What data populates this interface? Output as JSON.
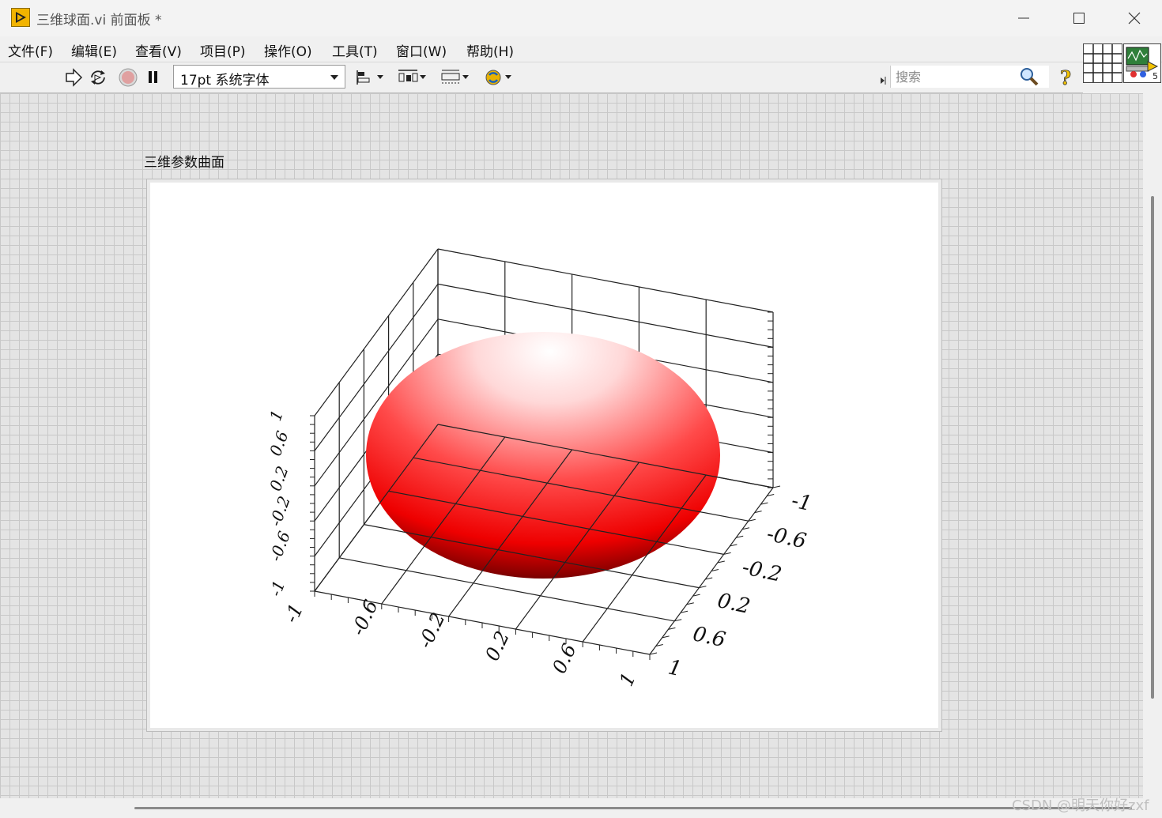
{
  "window": {
    "title": "三维球面.vi 前面板 *"
  },
  "menu": {
    "items": [
      "文件(F)",
      "编辑(E)",
      "查看(V)",
      "项目(P)",
      "操作(O)",
      "工具(T)",
      "窗口(W)",
      "帮助(H)"
    ]
  },
  "toolbar": {
    "font_value": "17pt 系统字体",
    "search_placeholder": "搜索",
    "icons": [
      "run-arrow-icon",
      "run-continuously-icon",
      "abort-icon",
      "pause-icon",
      "align-icon",
      "distribute-icon",
      "resize-icon",
      "reorder-icon",
      "search-icon",
      "help-icon"
    ]
  },
  "vi_icon": {
    "number": "5"
  },
  "panel": {
    "graph_label": "三维参数曲面"
  },
  "watermark": "CSDN @明天你好zxf",
  "chart_data": {
    "type": "surface",
    "surface": "sphere",
    "surface_color": "#ff0000",
    "radius": 1,
    "x_ticks": [
      "-1",
      "-0.6",
      "-0.2",
      "0.2",
      "0.6",
      "1"
    ],
    "y_ticks": [
      "-1",
      "-0.6",
      "-0.2",
      "0.2",
      "0.6",
      "1"
    ],
    "z_ticks": [
      "-1",
      "-0.6",
      "-0.2",
      "0.2",
      "0.6",
      "1"
    ],
    "x_range": [
      -1,
      1
    ],
    "y_range": [
      -1,
      1
    ],
    "z_range": [
      -1,
      1
    ],
    "grid": true
  }
}
